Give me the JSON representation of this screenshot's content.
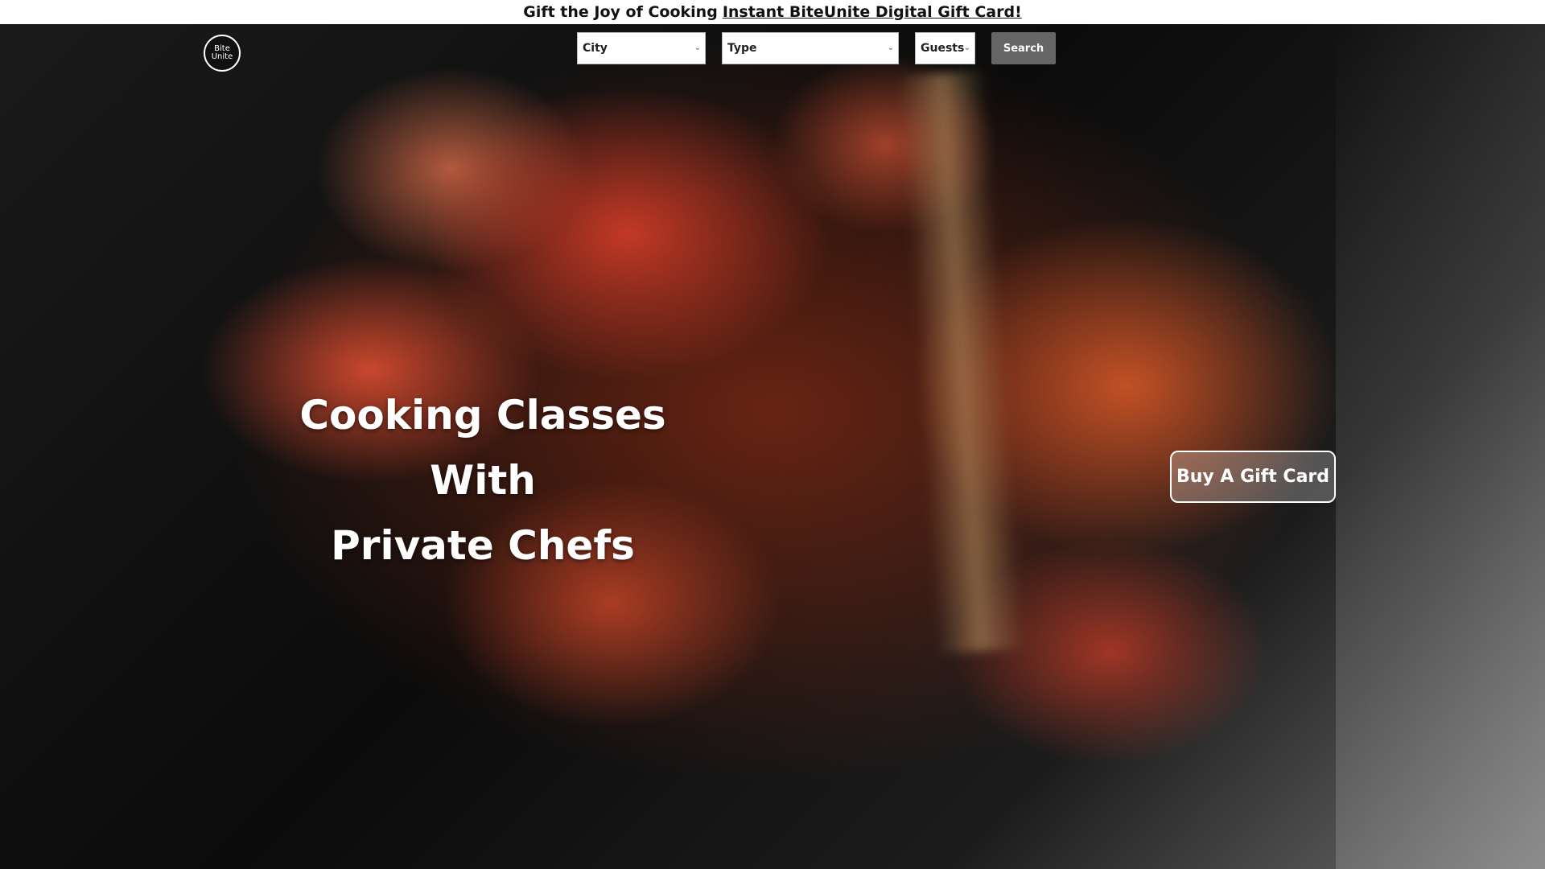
{
  "promo": {
    "text": "Gift the Joy of Cooking",
    "link": "Instant BiteUnite Digital Gift Card!"
  },
  "logo": {
    "line1": "Bite",
    "line2": "Unite"
  },
  "search": {
    "city": "City",
    "type": "Type",
    "guests": "Guests",
    "button": "Search"
  },
  "hero": {
    "headline_line1": "Cooking Classes With",
    "headline_line2": "Private Chefs",
    "gift_button": "Buy A Gift Card"
  },
  "icons": {
    "dropdown": "chevron-down-icon"
  }
}
